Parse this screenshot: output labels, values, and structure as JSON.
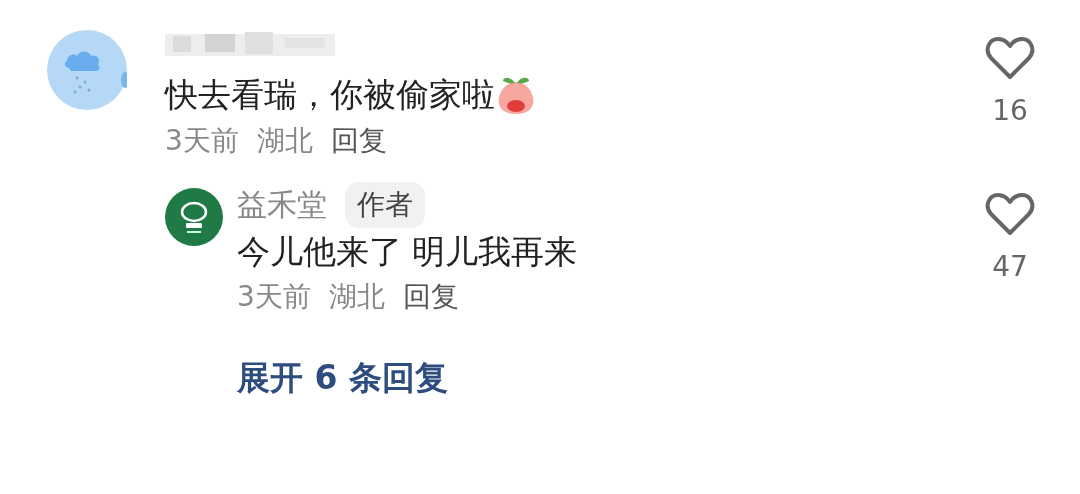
{
  "comments": [
    {
      "text": "快去看瑞，你被偷家啦",
      "has_emoji": true,
      "time": "3天前",
      "location": "湖北",
      "reply_label": "回复",
      "liked": false,
      "likes": "16",
      "replies": [
        {
          "author": "益禾堂",
          "badge": "作者",
          "text": "今儿他来了 明儿我再来",
          "time": "3天前",
          "location": "湖北",
          "reply_label": "回复",
          "liked": false,
          "likes": "47"
        }
      ],
      "expand_label": "展开 6 条回复"
    }
  ]
}
